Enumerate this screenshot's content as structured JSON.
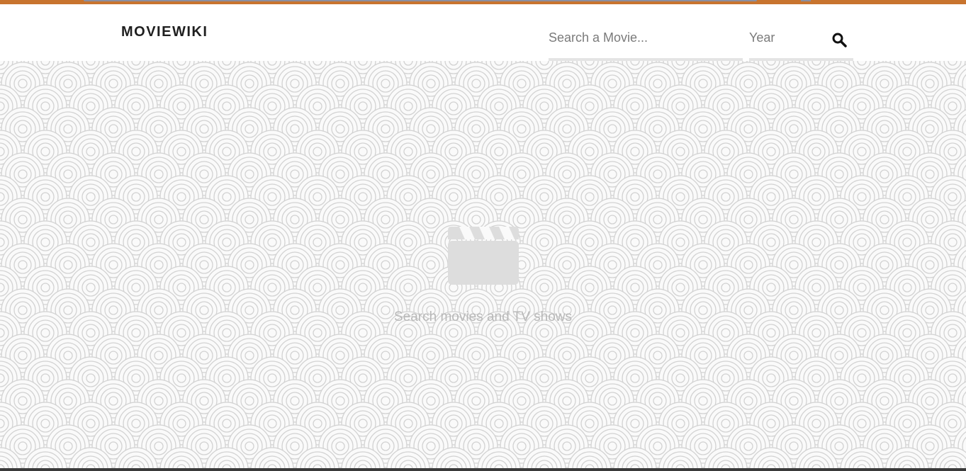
{
  "header": {
    "logo": "MOVIEWIKI",
    "search_placeholder": "Search a Movie...",
    "year_placeholder": "Year",
    "search_icon": "search-icon"
  },
  "main": {
    "empty_icon": "clapperboard-icon",
    "empty_text": "Search movies and TV shows"
  },
  "colors": {
    "top_strip": "#c8742e",
    "logo": "#1f1f1f",
    "empty_text": "#b8b8b8",
    "icon": "#dddddd"
  }
}
